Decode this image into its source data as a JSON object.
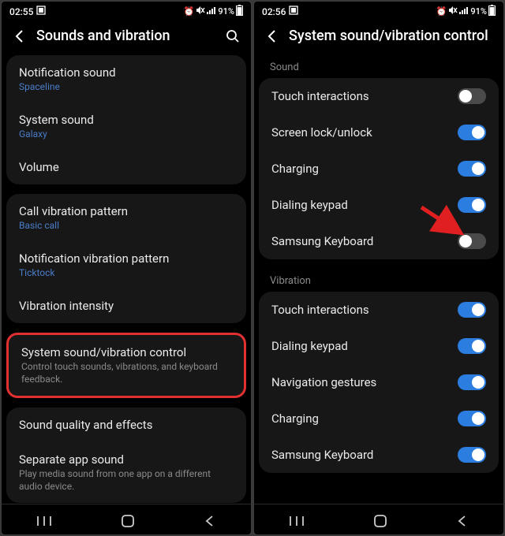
{
  "left": {
    "status": {
      "time": "02:55",
      "battery": "91%"
    },
    "header": {
      "title": "Sounds and vibration"
    },
    "cards": [
      {
        "rows": [
          {
            "label": "Notification sound",
            "sub": "Spaceline"
          },
          {
            "label": "System sound",
            "sub": "Galaxy"
          },
          {
            "label": "Volume"
          }
        ]
      },
      {
        "rows": [
          {
            "label": "Call vibration pattern",
            "sub": "Basic call"
          },
          {
            "label": "Notification vibration pattern",
            "sub": "Ticktock"
          },
          {
            "label": "Vibration intensity"
          }
        ]
      },
      {
        "highlight": true,
        "rows": [
          {
            "label": "System sound/vibration control",
            "desc": "Control touch sounds, vibrations, and keyboard feedback."
          }
        ]
      },
      {
        "rows": [
          {
            "label": "Sound quality and effects"
          },
          {
            "label": "Separate app sound",
            "desc": "Play media sound from one app on a different audio device."
          }
        ]
      }
    ]
  },
  "right": {
    "status": {
      "time": "02:56",
      "battery": "91%"
    },
    "header": {
      "title": "System sound/vibration control"
    },
    "sections": [
      {
        "label": "Sound",
        "rows": [
          {
            "label": "Touch interactions",
            "toggle": "off"
          },
          {
            "label": "Screen lock/unlock",
            "toggle": "on"
          },
          {
            "label": "Charging",
            "toggle": "on"
          },
          {
            "label": "Dialing keypad",
            "toggle": "on"
          },
          {
            "label": "Samsung Keyboard",
            "toggle": "off",
            "arrow": true
          }
        ]
      },
      {
        "label": "Vibration",
        "rows": [
          {
            "label": "Touch interactions",
            "toggle": "on"
          },
          {
            "label": "Dialing keypad",
            "toggle": "on"
          },
          {
            "label": "Navigation gestures",
            "toggle": "on"
          },
          {
            "label": "Charging",
            "toggle": "on"
          },
          {
            "label": "Samsung Keyboard",
            "toggle": "on"
          }
        ]
      }
    ]
  }
}
